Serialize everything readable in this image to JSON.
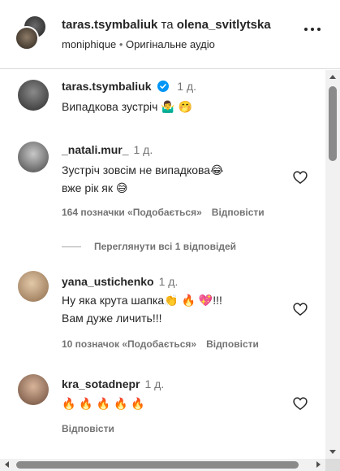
{
  "header": {
    "user1": "taras.tsymbaliuk",
    "connector": " та ",
    "user2": "olena_svitlytska",
    "audio_author": "moniphique",
    "separator": " • ",
    "audio_label": "Оригінальне аудіо",
    "more_icon": "more-horizontal-icon"
  },
  "caption": {
    "username": "taras.tsymbaliuk",
    "verified": true,
    "time": "1 д.",
    "text": "Випадкова зустріч 🤷‍♂️ 🤭"
  },
  "comments": [
    {
      "username": "_natali.mur_",
      "time": "1 д.",
      "lines": [
        "Зустріч зовсім не випадкова😂",
        "вже рік як 😅"
      ],
      "likes": "164 позначки «Подобається»",
      "reply": "Відповісти"
    },
    {
      "username": "yana_ustichenko",
      "time": "1 д.",
      "lines": [
        "Ну яка крута шапка👏 🔥 💖!!!",
        "Вам дуже личить!!!"
      ],
      "likes": "10 позначок «Подобається»",
      "reply": "Відповісти"
    },
    {
      "username": "kra_sotadnepr",
      "time": "1 д.",
      "lines": [
        "🔥 🔥 🔥 🔥 🔥"
      ],
      "reply": "Відповісти"
    }
  ],
  "view_replies": "Переглянути всі 1 відповідей",
  "colors": {
    "text": "#262626",
    "secondary": "#737373",
    "verified": "#0095f6",
    "border": "#dbdbdb"
  }
}
